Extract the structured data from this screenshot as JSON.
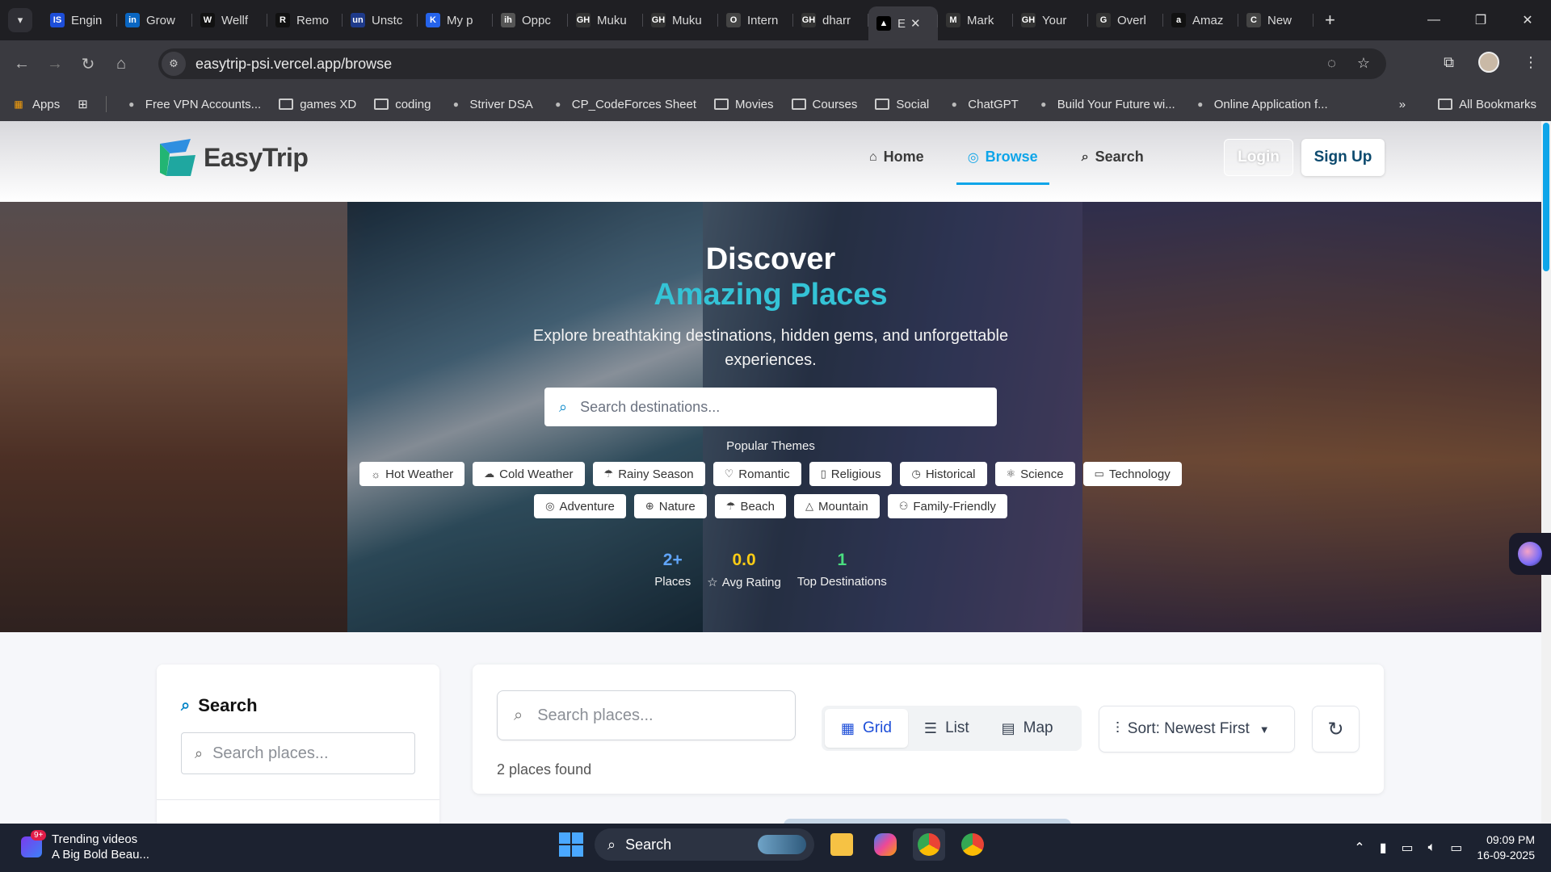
{
  "browser": {
    "tabs": [
      {
        "label": "Engin",
        "fav": "IS",
        "color": "#1d4ed8"
      },
      {
        "label": "Grow",
        "fav": "in",
        "color": "#0a66c2"
      },
      {
        "label": "Wellf",
        "fav": "W",
        "color": "#111111"
      },
      {
        "label": "Remo",
        "fav": "R",
        "color": "#111111"
      },
      {
        "label": "Unstc",
        "fav": "un",
        "color": "#1e3a8a"
      },
      {
        "label": "My p",
        "fav": "K",
        "color": "#2563eb"
      },
      {
        "label": "Oppc",
        "fav": "ih",
        "color": "#555555"
      },
      {
        "label": "Muku",
        "fav": "GH",
        "color": "#333333"
      },
      {
        "label": "Muku",
        "fav": "GH",
        "color": "#333333"
      },
      {
        "label": "Intern",
        "fav": "O",
        "color": "#444444"
      },
      {
        "label": "dharr",
        "fav": "GH",
        "color": "#333333"
      },
      {
        "label": "E",
        "fav": "▲",
        "color": "#000000",
        "active": true
      },
      {
        "label": "Mark",
        "fav": "M",
        "color": "#333333"
      },
      {
        "label": "Your",
        "fav": "GH",
        "color": "#333333"
      },
      {
        "label": "Overl",
        "fav": "G",
        "color": "#333333"
      },
      {
        "label": "Amaz",
        "fav": "a",
        "color": "#111111"
      },
      {
        "label": "New",
        "fav": "C",
        "color": "#444444"
      }
    ],
    "url": "easytrip-psi.vercel.app/browse",
    "bookmarks": [
      {
        "label": "Apps",
        "type": "apps"
      },
      {
        "label": "Free VPN Accounts...",
        "type": "site"
      },
      {
        "label": "games XD",
        "type": "folder"
      },
      {
        "label": "coding",
        "type": "folder"
      },
      {
        "label": "Striver DSA",
        "type": "site"
      },
      {
        "label": "CP_CodeForces Sheet",
        "type": "site"
      },
      {
        "label": "Movies",
        "type": "folder"
      },
      {
        "label": "Courses",
        "type": "folder"
      },
      {
        "label": "Social",
        "type": "folder"
      },
      {
        "label": "ChatGPT",
        "type": "site"
      },
      {
        "label": "Build Your Future wi...",
        "type": "site"
      },
      {
        "label": "Online Application f...",
        "type": "site"
      }
    ],
    "all_bookmarks": "All Bookmarks"
  },
  "header": {
    "brand": "EasyTrip",
    "nav": [
      {
        "label": "Home",
        "icon": "home-icon",
        "active": false
      },
      {
        "label": "Browse",
        "icon": "compass-icon",
        "active": true
      },
      {
        "label": "Search",
        "icon": "search-icon",
        "active": false
      }
    ],
    "login": "Login",
    "signup": "Sign Up",
    "accent": "#0ea5e9"
  },
  "hero": {
    "title_line1": "Discover",
    "title_line2": "Amazing Places",
    "subtitle": "Explore breathtaking destinations, hidden gems, and unforgettable experiences.",
    "search_placeholder": "Search destinations...",
    "themes_title": "Popular Themes",
    "themes_row1": [
      {
        "label": "Hot Weather",
        "icon": "☼"
      },
      {
        "label": "Cold Weather",
        "icon": "☁"
      },
      {
        "label": "Rainy Season",
        "icon": "☂"
      },
      {
        "label": "Romantic",
        "icon": "♡"
      },
      {
        "label": "Religious",
        "icon": "▯"
      },
      {
        "label": "Historical",
        "icon": "◷"
      },
      {
        "label": "Science",
        "icon": "⚛"
      },
      {
        "label": "Technology",
        "icon": "▭"
      }
    ],
    "themes_row2": [
      {
        "label": "Adventure",
        "icon": "◎"
      },
      {
        "label": "Nature",
        "icon": "⊕"
      },
      {
        "label": "Beach",
        "icon": "☂"
      },
      {
        "label": "Mountain",
        "icon": "△"
      },
      {
        "label": "Family-Friendly",
        "icon": "⚇"
      }
    ],
    "stats": [
      {
        "value": "2+",
        "label": "Places",
        "color": "#60a5fa",
        "icon": ""
      },
      {
        "value": "0.0",
        "label": "Avg Rating",
        "color": "#facc15",
        "icon": "☆"
      },
      {
        "value": "1",
        "label": "Top Destinations",
        "color": "#4ade80",
        "icon": ""
      }
    ]
  },
  "sidebar": {
    "title": "Search",
    "placeholder": "Search places..."
  },
  "main": {
    "placeholder": "Search places...",
    "found": "2 places found",
    "views": [
      {
        "label": "Grid",
        "icon": "grid-icon",
        "active": true
      },
      {
        "label": "List",
        "icon": "list-icon",
        "active": false
      },
      {
        "label": "Map",
        "icon": "map-icon",
        "active": false
      }
    ],
    "sort": "Sort: Newest First"
  },
  "taskbar": {
    "news_badge": "9+",
    "news_title": "Trending videos",
    "news_sub": "A Big Bold Beau...",
    "search": "Search",
    "time": "09:09 PM",
    "date": "16-09-2025"
  }
}
